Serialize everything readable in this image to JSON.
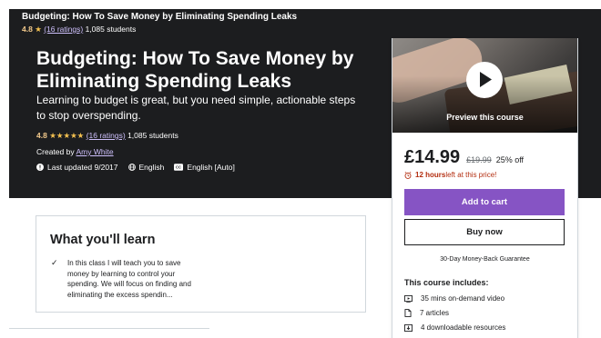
{
  "sticky_header": {
    "title": "Budgeting: How To Save Money by Eliminating Spending Leaks",
    "rating": "4.8",
    "star": "★",
    "ratings_link": "(16 ratings)",
    "students": "1,085 students"
  },
  "hero": {
    "title": "Budgeting: How To Save Money by Eliminating Spending Leaks",
    "subtitle": "Learning to budget is great, but you need simple, actionable steps to stop overspending.",
    "rating": "4.8",
    "stars": "★★★★★",
    "ratings_link": "(16 ratings)",
    "students": "1,085 students",
    "created_by_label": "Created by",
    "author": "Amy White",
    "last_updated": "Last updated 9/2017",
    "language": "English",
    "captions": "English [Auto]"
  },
  "learn": {
    "title": "What you'll learn",
    "check": "✓",
    "item": "In this class I will teach you to save money by learning to control your spending. We will focus on finding and eliminating the excess spendin..."
  },
  "sidebar": {
    "preview_label": "Preview this course",
    "price": "£14.99",
    "original_price": "£19.99",
    "discount": "25% off",
    "timer_bold": "12 hours",
    "timer_rest": " left at this price!",
    "add_to_cart": "Add to cart",
    "buy_now": "Buy now",
    "guarantee": "30-Day Money-Back Guarantee",
    "includes_title": "This course includes:",
    "includes": [
      {
        "icon": "video-icon",
        "label": "35 mins on-demand video"
      },
      {
        "icon": "article-icon",
        "label": "7 articles"
      },
      {
        "icon": "download-icon",
        "label": "4 downloadable resources"
      }
    ]
  },
  "colors": {
    "dark_bg": "#1c1d1f",
    "accent_purple": "#8654c4",
    "link_purple": "#cec0fc",
    "star_gold": "#f4c150",
    "timer_red": "#b32d0f"
  }
}
